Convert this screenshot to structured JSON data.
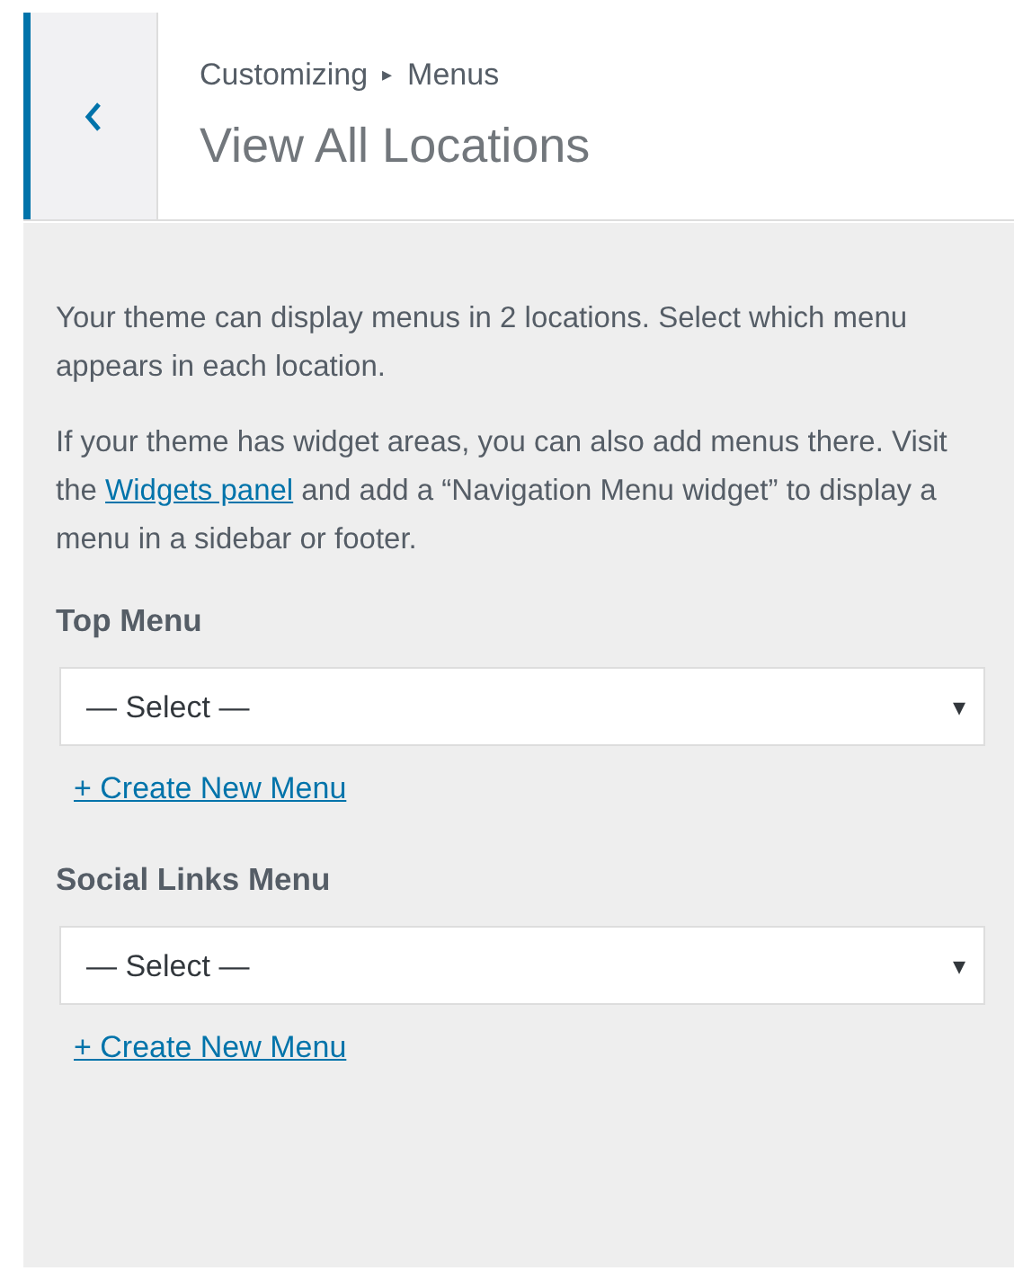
{
  "header": {
    "breadcrumb": [
      "Customizing",
      "Menus"
    ],
    "separator": "▸",
    "title": "View All Locations"
  },
  "description": "Your theme can display menus in 2 locations. Select which menu appears in each location.",
  "widgets_note": {
    "before": "If your theme has widget areas, you can also add menus there. Visit the",
    "link": "Widgets panel",
    "after": "and add a “Navigation Menu widget” to display a menu in a sidebar or footer."
  },
  "locations": [
    {
      "label": "Top Menu",
      "value": "— Select —",
      "arrow": "▾",
      "create_link": "+ Create New Menu"
    },
    {
      "label": "Social Links Menu",
      "value": "— Select —",
      "arrow": "▾",
      "create_link": "+ Create New Menu"
    }
  ]
}
